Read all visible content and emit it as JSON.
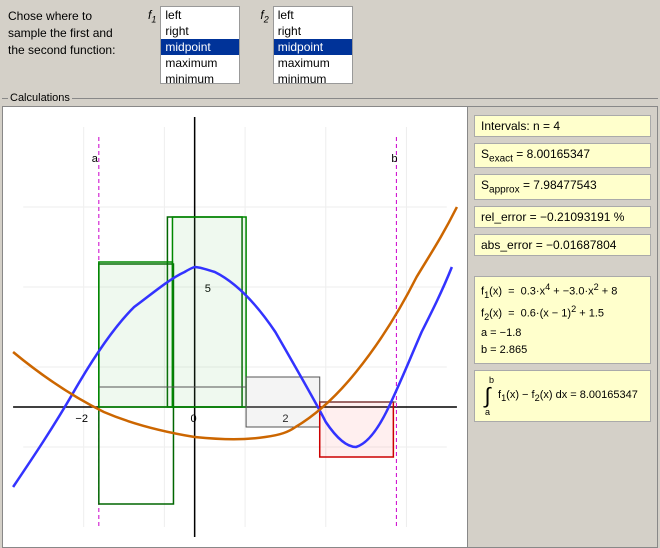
{
  "instruction": {
    "line1": "Chose where to",
    "line2": "sample the first and",
    "line3": "the second function:"
  },
  "f1": {
    "label": "f",
    "sub": "1",
    "options": [
      "left",
      "right",
      "midpoint",
      "maximum",
      "minimum"
    ],
    "selected": "midpoint"
  },
  "f2": {
    "label": "f",
    "sub": "2",
    "options": [
      "left",
      "right",
      "midpoint",
      "maximum",
      "minimum"
    ],
    "selected": "midpoint"
  },
  "calc_label": "Calculations",
  "right_panel": {
    "intervals_label": "Intervals:  n = 4",
    "s_exact_label": "S",
    "s_exact_sub": "exact",
    "s_exact_value": "= 8.00165347",
    "s_approx_label": "S",
    "s_approx_sub": "approx",
    "s_approx_value": "= 7.98477543",
    "rel_error": "rel_error = −0.21093191 %",
    "abs_error": "abs_error = −0.01687804",
    "formula1": "f₁(x)  =  0.3·x⁴ + −3.0·x² + 8",
    "formula2": "f₂(x)  =  0.6·(x − 1)² + 1.5",
    "a_val": "a = −1.8",
    "b_val": "b = 2.865",
    "integral": "∫  f₁(x) − f₂(x) dx = 8.00165347",
    "integral_from": "a",
    "integral_to": "b"
  }
}
